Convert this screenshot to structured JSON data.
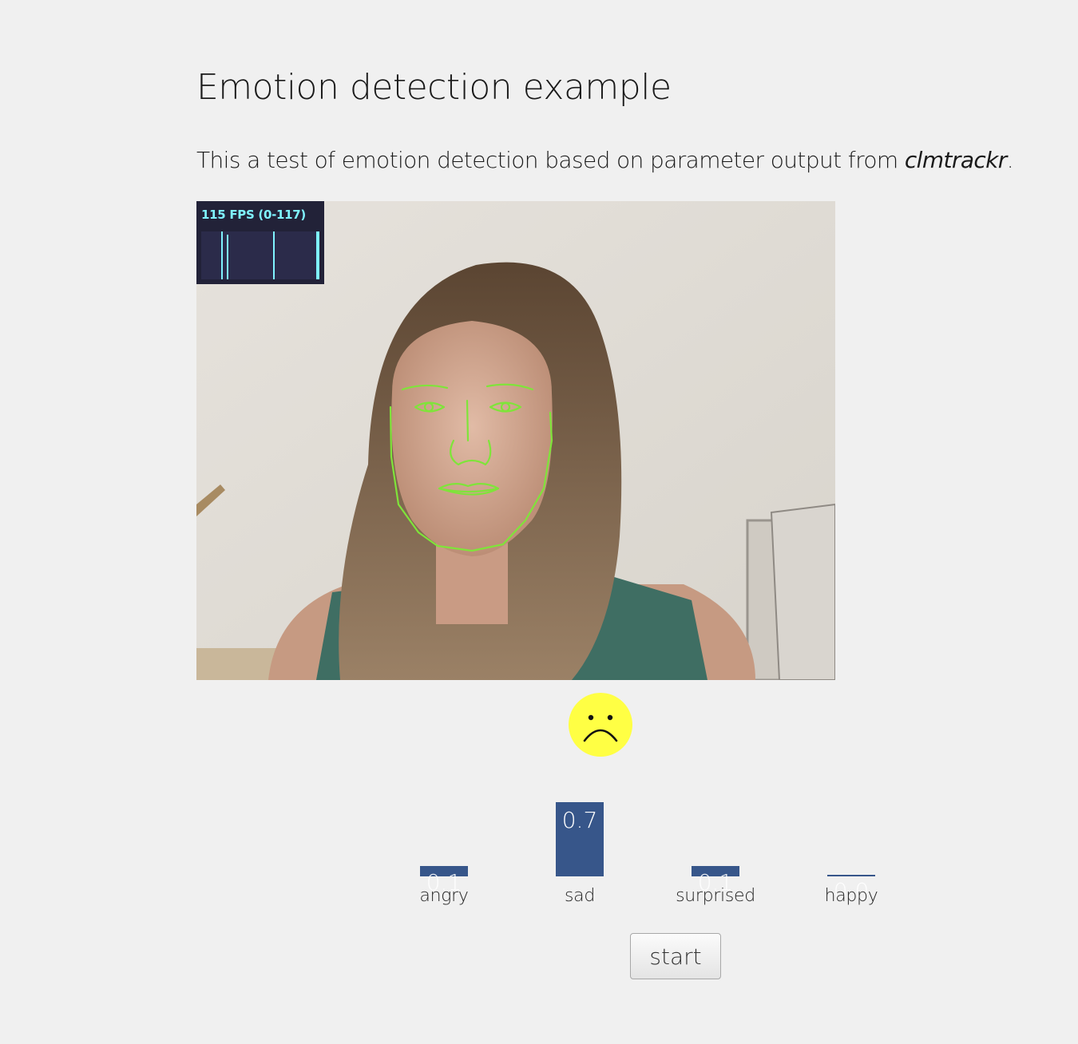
{
  "page": {
    "title": "Emotion detection example",
    "intro_prefix": "This a test of emotion detection based on parameter output from ",
    "intro_emph": "clmtrackr",
    "intro_suffix": "."
  },
  "stats": {
    "fps_label": "115 FPS (0-117)"
  },
  "emoji": {
    "icon": "sad-face-icon",
    "color": "#ffff44"
  },
  "chart_data": {
    "type": "bar",
    "categories": [
      "angry",
      "sad",
      "surprised",
      "happy"
    ],
    "values": [
      0.1,
      0.7,
      0.1,
      0.0
    ],
    "value_labels": [
      "0.1",
      "0.7",
      "0.1",
      "0.0"
    ],
    "ylim": [
      0,
      1
    ],
    "bar_color": "#37568a"
  },
  "controls": {
    "start_label": "start"
  }
}
